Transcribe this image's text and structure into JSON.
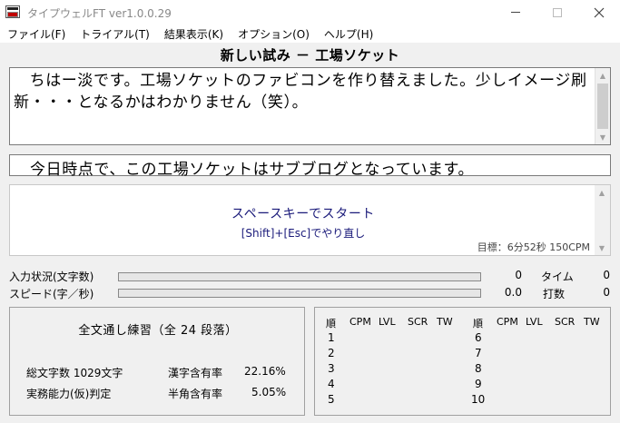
{
  "window": {
    "title": "タイプウェルFT ver1.0.0.29",
    "minimize": "—",
    "maximize": "□",
    "close": "✕"
  },
  "menu": [
    "ファイル(F)",
    "トライアル(T)",
    "結果表示(K)",
    "オプション(O)",
    "ヘルプ(H)"
  ],
  "text_title": "新しい試み － 工場ソケット",
  "source_text": "　ちはー淡です。工場ソケットのファビコンを作り替えました。少しイメージ刷新・・・となるかはわかりません（笑）。",
  "current_sentence": "今日時点で、この工場ソケットはサブブログとなっています。",
  "input": {
    "start_prompt": "スペースキーでスタート",
    "redo_hint": "[Shift]+[Esc]でやり直し",
    "target": "目標：6分52秒 150CPM"
  },
  "progress": {
    "input_label": "入力状況(文字数)",
    "input_count": "0",
    "input_fraction": 0,
    "time_label": "タイム",
    "time_value": "0",
    "speed_label": "スピード(字／秒)",
    "speed_value": "0.0",
    "speed_fraction": 0,
    "keystroke_label": "打数",
    "keystroke_value": "0"
  },
  "summary": {
    "practice_title": "全文通し練習（全 24 段落）",
    "total_chars": "総文字数 1029文字",
    "kanji_rate_label": "漢字含有率",
    "kanji_rate": "22.16%",
    "practical_label": "実務能力(仮)判定",
    "halfwidth_rate_label": "半角含有率",
    "halfwidth_rate": "5.05%"
  },
  "results": {
    "headers": [
      "順",
      "CPM",
      "LVL",
      "SCR",
      "TW"
    ],
    "left_rows": [
      "1",
      "2",
      "3",
      "4",
      "5"
    ],
    "right_rows": [
      "6",
      "7",
      "8",
      "9",
      "10"
    ]
  }
}
